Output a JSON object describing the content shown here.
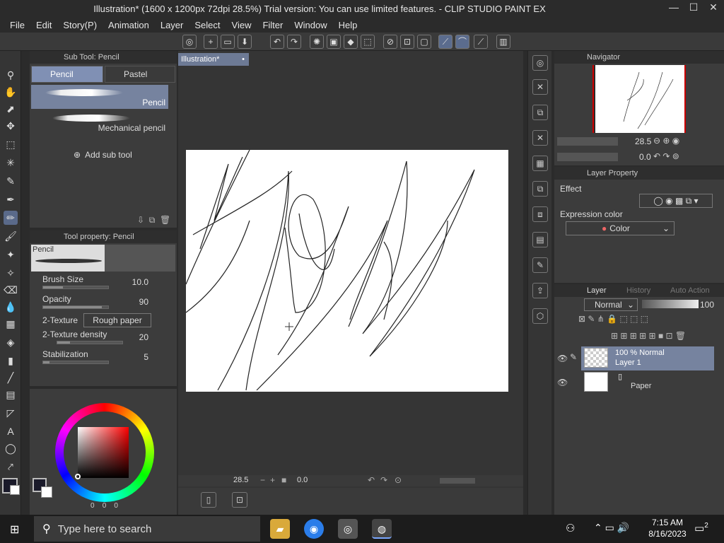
{
  "window": {
    "title": "Illustration* (1600 x 1200px 72dpi 28.5%)  Trial version: You can use limited features. - CLIP STUDIO PAINT EX",
    "minimize": "—",
    "maximize": "☐",
    "close": "✕"
  },
  "menu": [
    "File",
    "Edit",
    "Story(P)",
    "Animation",
    "Layer",
    "Select",
    "View",
    "Filter",
    "Window",
    "Help"
  ],
  "subtool": {
    "panel_title": "Sub Tool: Pencil",
    "tabs": [
      "Pencil",
      "Pastel"
    ],
    "items": [
      "Pencil",
      "Mechanical pencil"
    ],
    "add_label": "Add sub tool"
  },
  "toolprop": {
    "panel_title": "Tool property: Pencil",
    "preview_label": "Pencil",
    "brush_size_label": "Brush Size",
    "brush_size_value": "10.0",
    "brush_size_fill": 0.3,
    "opacity_label": "Opacity",
    "opacity_value": "90",
    "opacity_fill": 0.9,
    "texture_label": "2-Texture",
    "texture_value": "Rough paper",
    "density_label": "2-Texture density",
    "density_value": "20",
    "density_fill": 0.2,
    "stabilization_label": "Stabilization",
    "stabilization_value": "5",
    "stabilization_fill": 0.1
  },
  "color": {
    "main": "#1a1a2a",
    "sub": "#ffffff",
    "readout_1": "0",
    "readout_2": "0",
    "readout_3": "0"
  },
  "document": {
    "tab_label": "Illustration*",
    "zoom": "28.5",
    "rotation": "0.0"
  },
  "navigator": {
    "panel_title": "Navigator",
    "zoom": "28.5",
    "rotation": "0.0"
  },
  "layer_property": {
    "panel_title": "Layer Property",
    "effect_label": "Effect",
    "expression_label": "Expression color",
    "expression_value": "Color"
  },
  "layer_panel": {
    "tabs": [
      "Layer",
      "History",
      "Auto Action"
    ],
    "blend_mode": "Normal",
    "opacity": "100",
    "layers": [
      {
        "line1": "100 % Normal",
        "line2": "Layer 1"
      },
      {
        "line1": "",
        "line2": "Paper"
      }
    ]
  },
  "taskbar": {
    "search_placeholder": "Type here to search",
    "time": "7:15 AM",
    "date": "8/16/2023",
    "notifications": "2"
  }
}
